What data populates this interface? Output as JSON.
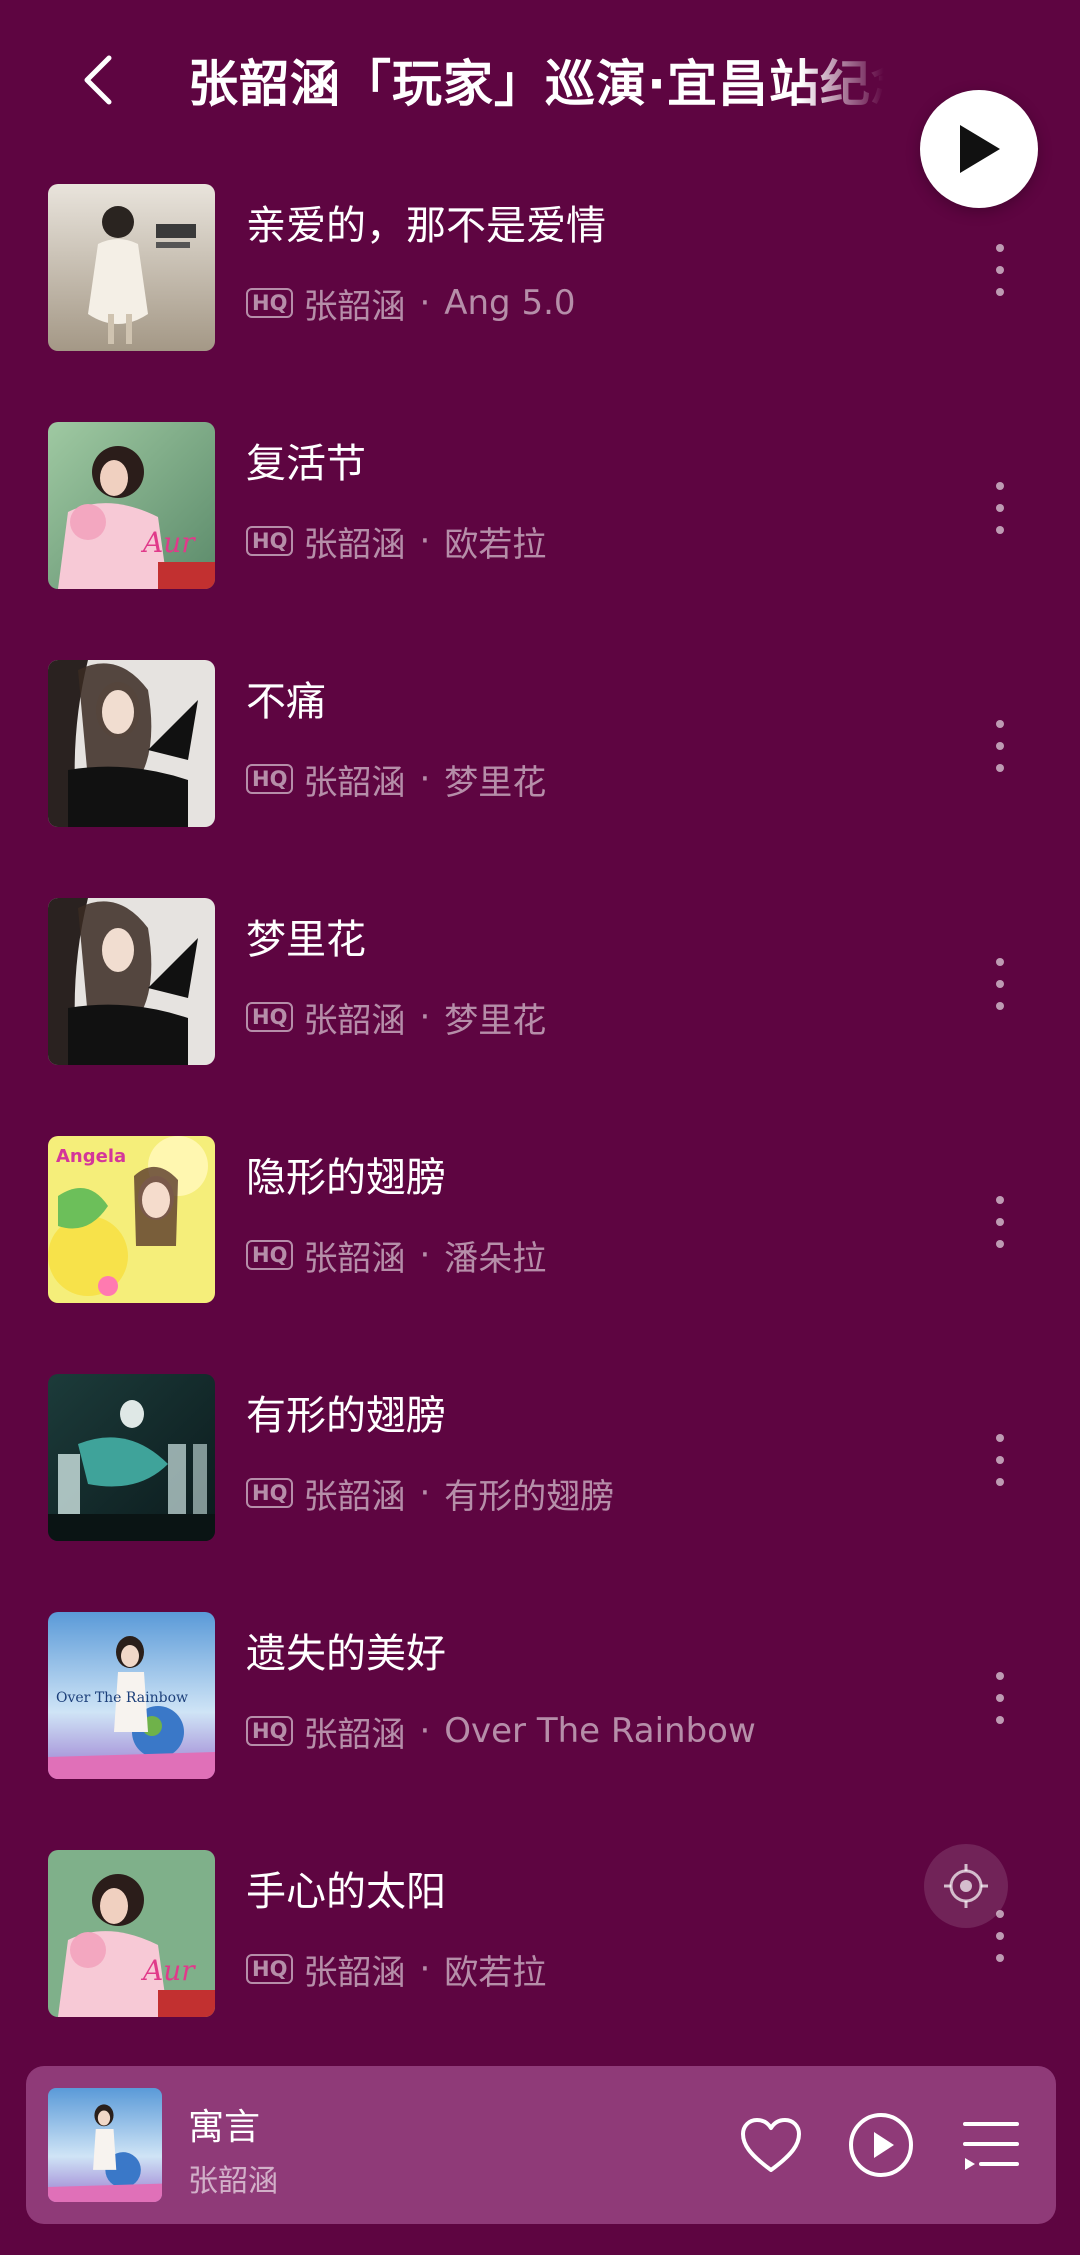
{
  "header": {
    "title": "张韶涵「玩家」巡演·宜昌站纪念歌单"
  },
  "songs": [
    {
      "title": "亲爱的，那不是爱情",
      "quality": "HQ",
      "artist": "张韶涵",
      "album": "Ang 5.0"
    },
    {
      "title": "复活节",
      "quality": "HQ",
      "artist": "张韶涵",
      "album": "欧若拉"
    },
    {
      "title": "不痛",
      "quality": "HQ",
      "artist": "张韶涵",
      "album": "梦里花"
    },
    {
      "title": "梦里花",
      "quality": "HQ",
      "artist": "张韶涵",
      "album": "梦里花"
    },
    {
      "title": "隐形的翅膀",
      "quality": "HQ",
      "artist": "张韶涵",
      "album": "潘朵拉"
    },
    {
      "title": "有形的翅膀",
      "quality": "HQ",
      "artist": "张韶涵",
      "album": "有形的翅膀"
    },
    {
      "title": "遗失的美好",
      "quality": "HQ",
      "artist": "张韶涵",
      "album": "Over The Rainbow"
    },
    {
      "title": "手心的太阳",
      "quality": "HQ",
      "artist": "张韶涵",
      "album": "欧若拉"
    }
  ],
  "separator": "·",
  "now_playing": {
    "title": "寓言",
    "artist": "张韶涵"
  },
  "icons": {
    "back": "chevron-left-icon",
    "play_all": "play-icon",
    "more": "more-vertical-icon",
    "locate": "locate-icon",
    "like": "heart-icon",
    "play": "play-circle-icon",
    "playlist": "playlist-icon"
  },
  "colors": {
    "background": "#5e0541",
    "mini_player": "#8f3a78",
    "text_primary": "#ffffff",
    "text_secondary": "rgba(255,255,255,0.55)"
  }
}
